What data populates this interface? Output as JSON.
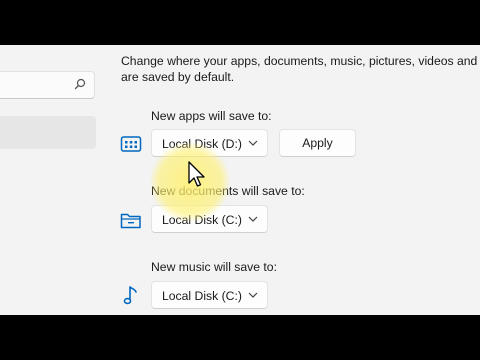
{
  "search": {
    "placeholder": ""
  },
  "description": {
    "line1": "Change where your apps, documents, music, pictures, videos and m",
    "line2": "are saved by default."
  },
  "apps": {
    "label": "New apps will save to:",
    "selected_drive": "Local Disk (D:)",
    "apply_label": "Apply"
  },
  "documents": {
    "label": "New documents will save to:",
    "selected_drive": "Local Disk (C:)"
  },
  "music": {
    "label": "New music will save to:",
    "selected_drive": "Local Disk (C:)"
  },
  "colors": {
    "accent": "#0067c0",
    "highlight": "#fff06e"
  },
  "icons": [
    "search-icon",
    "apps-grid-icon",
    "folder-icon",
    "music-note-icon",
    "chevron-down-icon",
    "mouse-cursor-icon"
  ]
}
